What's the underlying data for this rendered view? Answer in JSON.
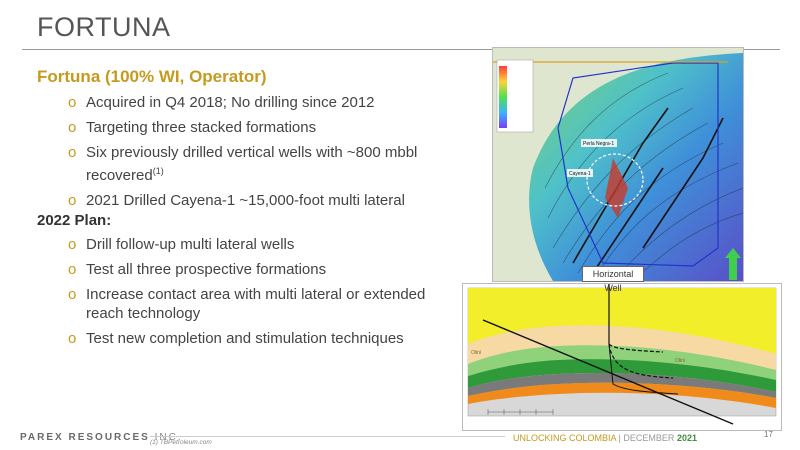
{
  "header": {
    "title": "FORTUNA"
  },
  "main": {
    "subhead": "Fortuna (100% WI, Operator)",
    "bullets1": [
      "Acquired in Q4 2018; No drilling since 2012",
      "Targeting three stacked formations",
      "Six previously drilled vertical wells with ~800 mbbl recovered",
      "2021 Drilled Cayena-1 ~15,000-foot multi lateral"
    ],
    "footnote_ref": "(1)",
    "plan_title": "2022 Plan:",
    "bullets2": [
      "Drill follow-up multi lateral wells",
      "Test all three prospective formations",
      "Increase contact area with multi lateral or extended reach technology",
      "Test new completion and stimulation techniques"
    ]
  },
  "map": {
    "labels": {
      "well1": "Perla Negra-1",
      "well2": "Cayena-1"
    }
  },
  "cross_section": {
    "callout": "Horizontal Well",
    "formations": [
      "Olini",
      "Olini"
    ]
  },
  "footer": {
    "company": "PAREX RESOURCES",
    "company_suffix": "INC.",
    "footnote": "(1) TBPetroleum.com",
    "tagline": "UNLOCKING COLOMBIA",
    "separator": "|",
    "month": "DECEMBER",
    "year": "2021",
    "page": "17"
  },
  "colors": {
    "accent": "#c59a1f",
    "green": "#3e8e3e"
  }
}
